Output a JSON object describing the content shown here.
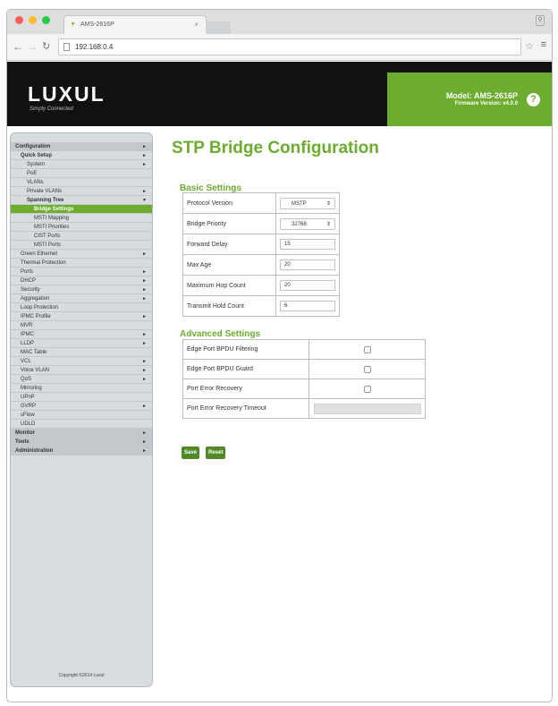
{
  "browser": {
    "tab_title": "AMS-2616P",
    "url": "192.168.0.4"
  },
  "header": {
    "logo": "LUXUL",
    "tagline": "Simply Connected",
    "model": "Model: AMS-2616P",
    "firmware": "Firmware Version: v4.0.0"
  },
  "sidebar": {
    "items": [
      {
        "label": "Configuration",
        "arrow": true
      },
      {
        "label": "Quick Setup",
        "arrow": true
      },
      {
        "label": "System",
        "arrow": true
      },
      {
        "label": "PoE",
        "arrow": false
      },
      {
        "label": "VLANs",
        "arrow": false
      },
      {
        "label": "Private VLANs",
        "arrow": true
      },
      {
        "label": "Spanning Tree",
        "arrow": true
      },
      {
        "label": "Bridge Settings",
        "arrow": false
      },
      {
        "label": "MSTI Mapping",
        "arrow": false
      },
      {
        "label": "MSTI Priorities",
        "arrow": false
      },
      {
        "label": "CIST Ports",
        "arrow": false
      },
      {
        "label": "MSTI Ports",
        "arrow": false
      },
      {
        "label": "Green Ethernet",
        "arrow": true
      },
      {
        "label": "Thermal Protection",
        "arrow": false
      },
      {
        "label": "Ports",
        "arrow": true
      },
      {
        "label": "DHCP",
        "arrow": true
      },
      {
        "label": "Security",
        "arrow": true
      },
      {
        "label": "Aggregation",
        "arrow": true
      },
      {
        "label": "Loop Protection",
        "arrow": false
      },
      {
        "label": "IPMC Profile",
        "arrow": true
      },
      {
        "label": "MVR",
        "arrow": false
      },
      {
        "label": "IPMC",
        "arrow": true
      },
      {
        "label": "LLDP",
        "arrow": true
      },
      {
        "label": "MAC Table",
        "arrow": false
      },
      {
        "label": "VCL",
        "arrow": true
      },
      {
        "label": "Voice VLAN",
        "arrow": true
      },
      {
        "label": "QoS",
        "arrow": true
      },
      {
        "label": "Mirroring",
        "arrow": false
      },
      {
        "label": "UPnP",
        "arrow": false
      },
      {
        "label": "GVRP",
        "arrow": true
      },
      {
        "label": "sFlow",
        "arrow": false
      },
      {
        "label": "UDLD",
        "arrow": false
      },
      {
        "label": "Monitor",
        "arrow": true
      },
      {
        "label": "Tools",
        "arrow": true
      },
      {
        "label": "Administration",
        "arrow": true
      }
    ],
    "copyright": "Copyright ©2014 Luxul"
  },
  "main": {
    "title": "STP Bridge Configuration",
    "basic_heading": "Basic Settings",
    "basic": [
      {
        "label": "Protocol Version",
        "value": "MSTP",
        "type": "select"
      },
      {
        "label": "Bridge Priority",
        "value": "32768",
        "type": "select"
      },
      {
        "label": "Forward Delay",
        "value": "15",
        "type": "input"
      },
      {
        "label": "Max Age",
        "value": "20",
        "type": "input"
      },
      {
        "label": "Maximum Hop Count",
        "value": "20",
        "type": "input"
      },
      {
        "label": "Transmit Hold Count",
        "value": "6",
        "type": "input"
      }
    ],
    "advanced_heading": "Advanced Settings",
    "advanced": [
      {
        "label": "Edge Port BPDU Filtering",
        "checked": false
      },
      {
        "label": "Edge Port BPDU Guard",
        "checked": false
      },
      {
        "label": "Port Error Recovery",
        "checked": false
      },
      {
        "label": "Port Error Recovery Timeout",
        "value": ""
      }
    ],
    "save_label": "Save",
    "reset_label": "Reset"
  },
  "colors": {
    "accent": "#6cac2f",
    "header_bg": "#111111",
    "sidebar_bg": "#d7dcdf",
    "button_bg": "#4f8a26"
  }
}
